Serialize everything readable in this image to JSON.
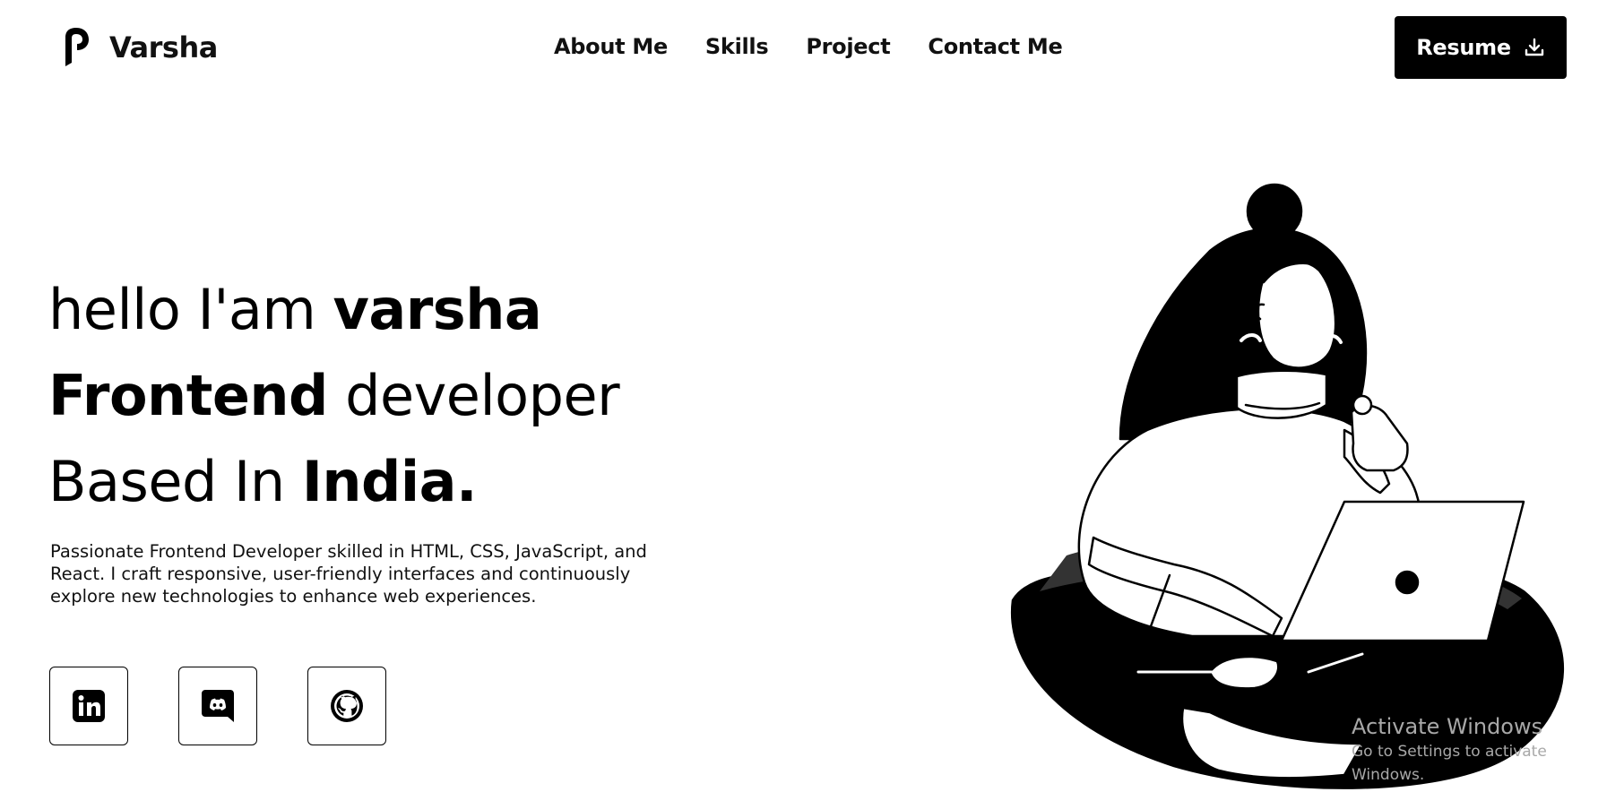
{
  "header": {
    "brand_name": "Varsha",
    "logo_icon": "varsha-logo-icon",
    "nav": [
      {
        "label": "About Me"
      },
      {
        "label": "Skills"
      },
      {
        "label": "Project"
      },
      {
        "label": "Contact Me"
      }
    ],
    "resume_label": "Resume",
    "resume_icon": "download-icon"
  },
  "hero": {
    "line1": {
      "light": "hello I'am ",
      "bold": "varsha"
    },
    "line2": {
      "bold": "Frontend",
      "light": " developer"
    },
    "line3": {
      "light": "Based In ",
      "bold": "India."
    },
    "description": "Passionate Frontend Developer skilled in HTML, CSS, JavaScript, and React. I craft responsive, user-friendly interfaces and continuously explore new technologies to enhance web experiences."
  },
  "socials": [
    {
      "icon": "linkedin-icon"
    },
    {
      "icon": "discord-icon"
    },
    {
      "icon": "github-icon"
    }
  ],
  "illustration": {
    "icon": "woman-with-laptop-illustration"
  },
  "watermark": {
    "title": "Activate Windows",
    "subtitle": "Go to Settings to activate Windows."
  },
  "colors": {
    "primary": "#000000",
    "background": "#ffffff",
    "watermark": "#a8a8a8"
  }
}
